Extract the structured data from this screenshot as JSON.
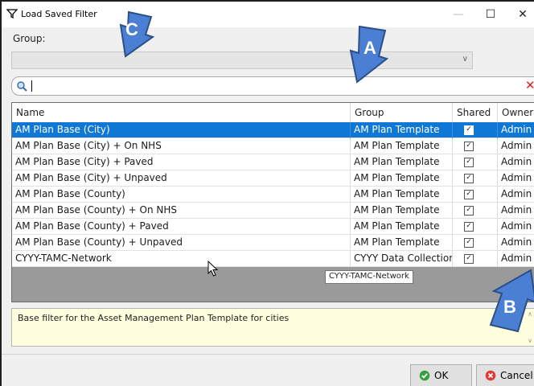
{
  "window": {
    "title": "Load Saved Filter"
  },
  "group": {
    "label": "Group:",
    "value": ""
  },
  "search": {
    "value": ""
  },
  "table": {
    "columns": [
      "Name",
      "Group",
      "Shared",
      "Owner"
    ],
    "rows": [
      {
        "name": "AM Plan Base (City)",
        "group": "AM Plan Template",
        "shared": true,
        "owner": "Admin",
        "selected": true
      },
      {
        "name": "AM Plan Base (City) + On NHS",
        "group": "AM Plan Template",
        "shared": true,
        "owner": "Admin"
      },
      {
        "name": "AM Plan Base (City) + Paved",
        "group": "AM Plan Template",
        "shared": true,
        "owner": "Admin"
      },
      {
        "name": "AM Plan Base (City) + Unpaved",
        "group": "AM Plan Template",
        "shared": true,
        "owner": "Admin"
      },
      {
        "name": "AM Plan Base (County)",
        "group": "AM Plan Template",
        "shared": true,
        "owner": "Admin"
      },
      {
        "name": "AM Plan Base (County) + On NHS",
        "group": "AM Plan Template",
        "shared": true,
        "owner": "Admin"
      },
      {
        "name": "AM Plan Base (County) + Paved",
        "group": "AM Plan Template",
        "shared": true,
        "owner": "Admin"
      },
      {
        "name": "AM Plan Base (County) + Unpaved",
        "group": "AM Plan Template",
        "shared": true,
        "owner": "Admin"
      },
      {
        "name": "CYYY-TAMC-Network",
        "group": "CYYY Data Collection",
        "shared": true,
        "owner": "Admin"
      }
    ]
  },
  "tooltip": {
    "text": "CYYY-TAMC-Network"
  },
  "description": {
    "text": "Base filter for the Asset Management Plan Template for cities"
  },
  "buttons": {
    "ok": "OK",
    "cancel": "Cancel"
  },
  "annotations": {
    "a": "A",
    "b": "B",
    "c": "C"
  },
  "colors": {
    "selection": "#0f78d7",
    "callout_fill": "#4a7fd4",
    "callout_stroke": "#2c4f86",
    "description_bg": "#ffffe0",
    "clear_icon": "#e02020"
  }
}
